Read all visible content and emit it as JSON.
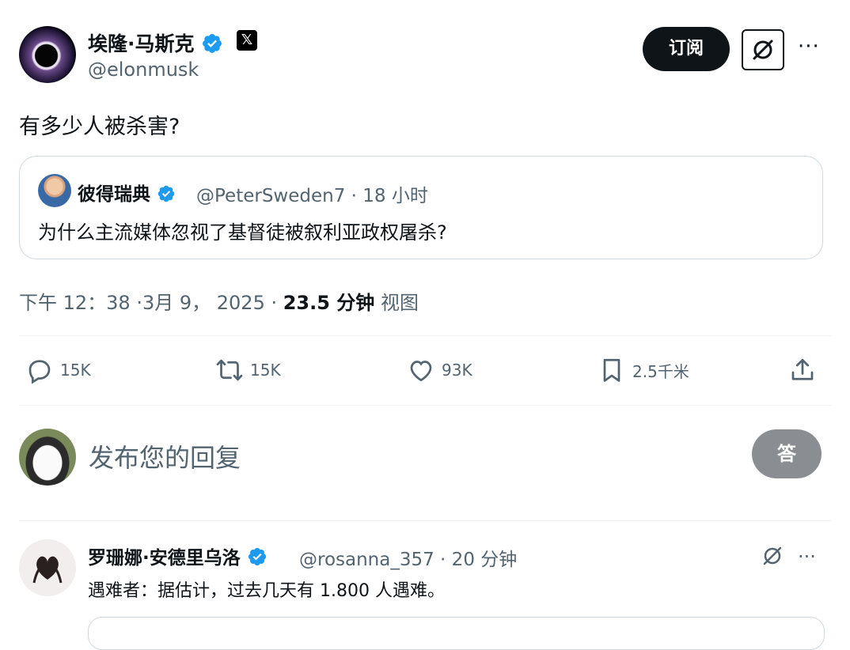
{
  "author": {
    "name": "埃隆·马斯克",
    "handle": "@elonmusk",
    "x_badge": "𝕏"
  },
  "header_actions": {
    "subscribe_label": "订阅",
    "more": "···"
  },
  "tweet": {
    "text": "有多少人被杀害?"
  },
  "quote": {
    "name": "彼得瑞典",
    "meta": "@PeterSweden7 · 18 小时",
    "text": "为什么主流媒体忽视了基督徒被叙利亚政权屠杀?"
  },
  "timestamp": {
    "datetime": "下午 12：38 ·3月 9， 2025 · ",
    "views_count": "23.5 分钟",
    "views_label": "视图"
  },
  "actions": {
    "reply_count": "15K",
    "retweet_count": "15K",
    "like_count": "93K",
    "bookmark_count": "2.5千米"
  },
  "composer": {
    "placeholder": "发布您的回复",
    "reply_button": "答"
  },
  "comment": {
    "name": "罗珊娜·安德里乌洛",
    "meta": "@rosanna_357 · 20 分钟",
    "text": "遇难者：据估计，过去几天有 1.800 人遇难。",
    "more": "···"
  },
  "colors": {
    "text": "#0f1419",
    "muted": "#536471",
    "verified": "#1d9bf0",
    "reply_button": "#8a8e93"
  }
}
